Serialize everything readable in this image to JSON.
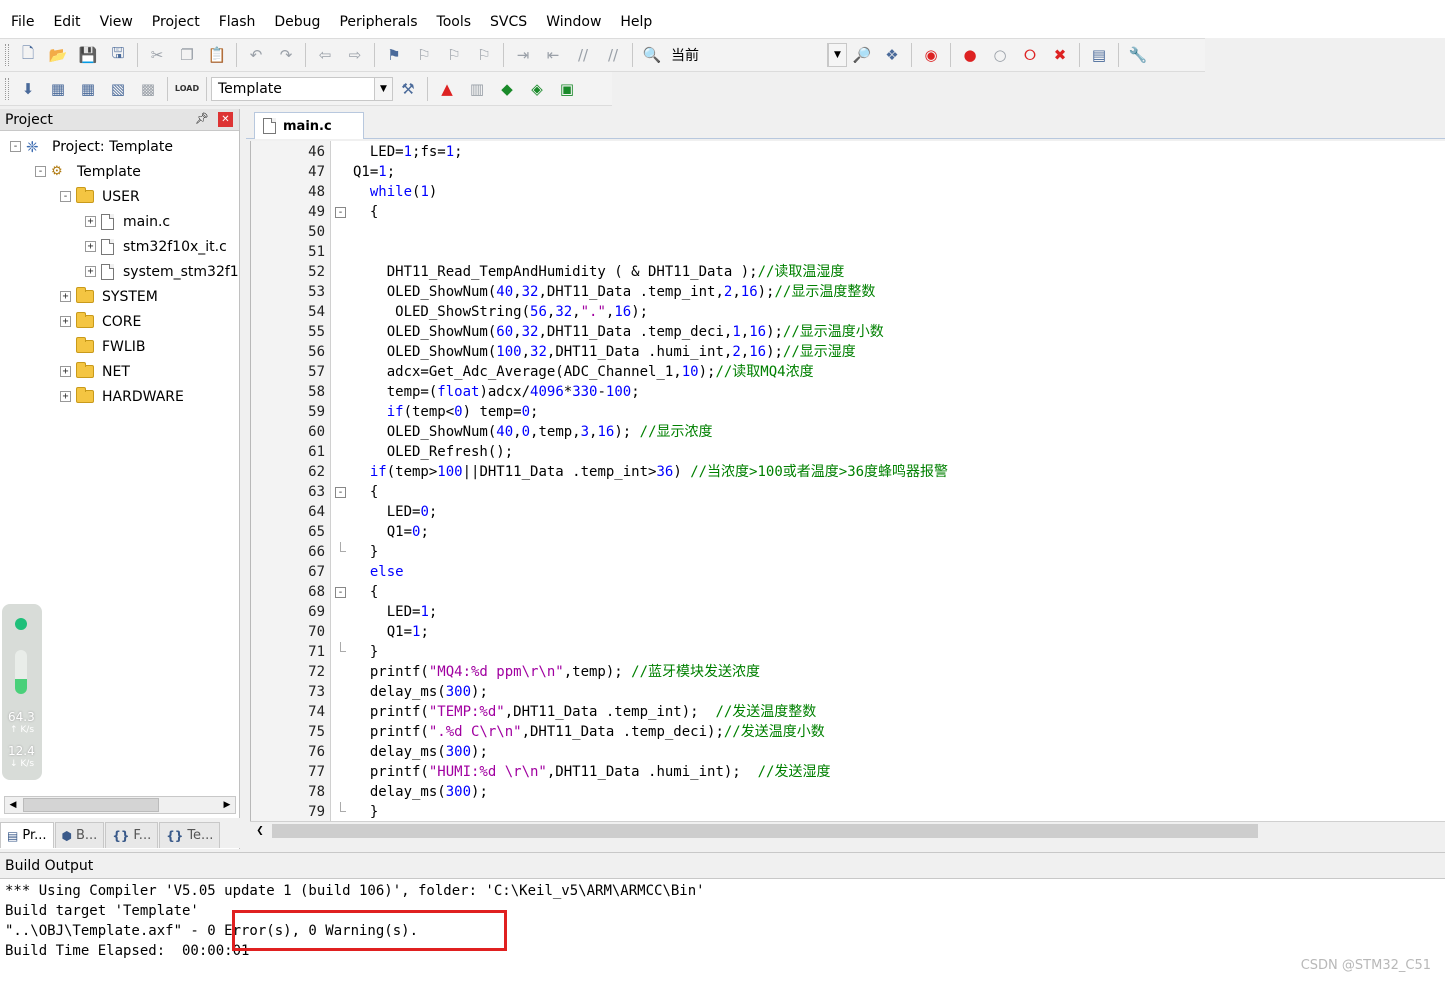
{
  "menubar": {
    "items": [
      "File",
      "Edit",
      "View",
      "Project",
      "Flash",
      "Debug",
      "Peripherals",
      "Tools",
      "SVCS",
      "Window",
      "Help"
    ]
  },
  "toolbar1": {
    "icons": [
      "new-file-icon",
      "open-file-icon",
      "save-icon",
      "save-all-icon",
      "cut-icon",
      "copy-icon",
      "paste-icon",
      "undo-icon",
      "redo-icon",
      "navigate-back-icon",
      "navigate-forward-icon",
      "insert-bookmark-icon",
      "previous-bookmark-icon",
      "next-bookmark-icon",
      "clear-bookmarks-icon",
      "indent-icon",
      "unindent-icon",
      "comment-icon",
      "uncomment-icon",
      "find-in-files-icon"
    ],
    "find_value": "当前",
    "right_icons": [
      "incremental-find-icon",
      "browse-icon",
      "debug-session-icon",
      "breakpoint-icon",
      "disable-breakpoint-icon",
      "disable-all-breakpoints-icon",
      "kill-breakpoints-icon",
      "window-layout-icon",
      "configure-icon"
    ]
  },
  "toolbar2": {
    "icons": [
      "translate-icon",
      "build-icon",
      "rebuild-icon",
      "batch-build-icon",
      "stop-build-icon",
      "download-icon"
    ],
    "download_glyph": "LOAD",
    "target_value": "Template",
    "right_icons": [
      "target-options-icon",
      "manage-components-icon",
      "file-extensions-icon",
      "select-pack-icon",
      "pack-installer-icon",
      "run-time-environment-icon"
    ]
  },
  "project": {
    "title": "Project",
    "root": "Project: Template",
    "target": "Template",
    "groups": [
      {
        "name": "USER",
        "expanded": true,
        "files": [
          "main.c",
          "stm32f10x_it.c",
          "system_stm32f1"
        ]
      },
      {
        "name": "SYSTEM",
        "expanded": false
      },
      {
        "name": "CORE",
        "expanded": false
      },
      {
        "name": "FWLIB",
        "expanded": false
      },
      {
        "name": "NET",
        "expanded": false
      },
      {
        "name": "HARDWARE",
        "expanded": false
      }
    ]
  },
  "net_widget": {
    "upload_value": "64.3",
    "upload_unit": "K/s",
    "download_value": "12.4",
    "download_unit": "K/s",
    "level": 0.35
  },
  "bottom_tabs": [
    "Pr...",
    "B...",
    "F...",
    "Te..."
  ],
  "editor": {
    "tab_label": "main.c",
    "lines": [
      {
        "no": "46",
        "text": "  LED=1;fs=1;"
      },
      {
        "no": "47",
        "text": "Q1=1;"
      },
      {
        "no": "48",
        "text": "  while(1)"
      },
      {
        "no": "49",
        "text": "  {",
        "fold": "open"
      },
      {
        "no": "50",
        "text": ""
      },
      {
        "no": "51",
        "text": ""
      },
      {
        "no": "52",
        "text": "    DHT11_Read_TempAndHumidity ( & DHT11_Data );//读取温湿度"
      },
      {
        "no": "53",
        "text": "    OLED_ShowNum(40,32,DHT11_Data .temp_int,2,16);//显示温度整数"
      },
      {
        "no": "54",
        "text": "     OLED_ShowString(56,32,\".\",16);"
      },
      {
        "no": "55",
        "text": "    OLED_ShowNum(60,32,DHT11_Data .temp_deci,1,16);//显示温度小数"
      },
      {
        "no": "56",
        "text": "    OLED_ShowNum(100,32,DHT11_Data .humi_int,2,16);//显示湿度"
      },
      {
        "no": "57",
        "text": "    adcx=Get_Adc_Average(ADC_Channel_1,10);//读取MQ4浓度"
      },
      {
        "no": "58",
        "text": "    temp=(float)adcx/4096*330-100;"
      },
      {
        "no": "59",
        "text": "    if(temp<0) temp=0;"
      },
      {
        "no": "60",
        "text": "    OLED_ShowNum(40,0,temp,3,16); //显示浓度"
      },
      {
        "no": "61",
        "text": "    OLED_Refresh();"
      },
      {
        "no": "62",
        "text": "  if(temp>100||DHT11_Data .temp_int>36) //当浓度>100或者温度>36度蜂鸣器报警"
      },
      {
        "no": "63",
        "text": "  {",
        "fold": "open"
      },
      {
        "no": "64",
        "text": "    LED=0;"
      },
      {
        "no": "65",
        "text": "    Q1=0;"
      },
      {
        "no": "66",
        "text": "  }",
        "fold": "end"
      },
      {
        "no": "67",
        "text": "  else"
      },
      {
        "no": "68",
        "text": "  {",
        "fold": "open"
      },
      {
        "no": "69",
        "text": "    LED=1;"
      },
      {
        "no": "70",
        "text": "    Q1=1;"
      },
      {
        "no": "71",
        "text": "  }",
        "fold": "end"
      },
      {
        "no": "72",
        "text": "  printf(\"MQ4:%d ppm\\r\\n\",temp); //蓝牙模块发送浓度"
      },
      {
        "no": "73",
        "text": "  delay_ms(300);"
      },
      {
        "no": "74",
        "text": "  printf(\"TEMP:%d\",DHT11_Data .temp_int);  //发送温度整数"
      },
      {
        "no": "75",
        "text": "  printf(\".%d C\\r\\n\",DHT11_Data .temp_deci);//发送温度小数"
      },
      {
        "no": "76",
        "text": "  delay_ms(300);"
      },
      {
        "no": "77",
        "text": "  printf(\"HUMI:%d \\r\\n\",DHT11_Data .humi_int);  //发送湿度"
      },
      {
        "no": "78",
        "text": "  delay_ms(300);"
      },
      {
        "no": "79",
        "text": "  }",
        "fold": "end"
      }
    ]
  },
  "build": {
    "title": "Build Output",
    "lines": [
      "*** Using Compiler 'V5.05 update 1 (build 106)', folder: 'C:\\Keil_v5\\ARM\\ARMCC\\Bin'",
      "Build target 'Template'",
      "\"..\\OBJ\\Template.axf\" - 0 Error(s), 0 Warning(s).",
      "Build Time Elapsed:  00:00:01"
    ]
  },
  "watermark": "CSDN @STM32_C51",
  "colors": {
    "keyword": "#0000ff",
    "number": "#0000ff",
    "string": "#a000a0",
    "comment": "#008000",
    "highlight": "#e02020"
  }
}
